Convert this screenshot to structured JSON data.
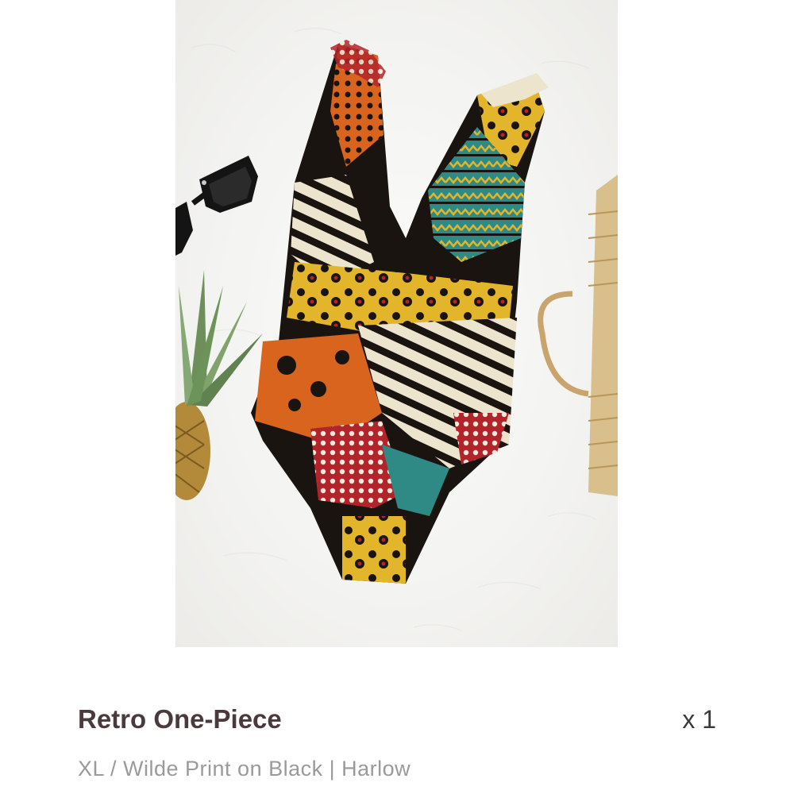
{
  "cart_item": {
    "title": "Retro One-Piece",
    "quantity_label": "x 1",
    "variant": "XL / Wilde Print on Black | Harlow"
  },
  "photo": {
    "props": [
      "sunglasses-icon",
      "pineapple-icon",
      "straw-bag-icon"
    ],
    "colors": {
      "background": "#f3f3f1",
      "print_black": "#1a1410",
      "print_orange": "#d8641e",
      "print_yellow": "#e2b52a",
      "print_red": "#b3242a",
      "print_cream": "#ece4cc",
      "print_teal": "#2f8a86"
    }
  }
}
